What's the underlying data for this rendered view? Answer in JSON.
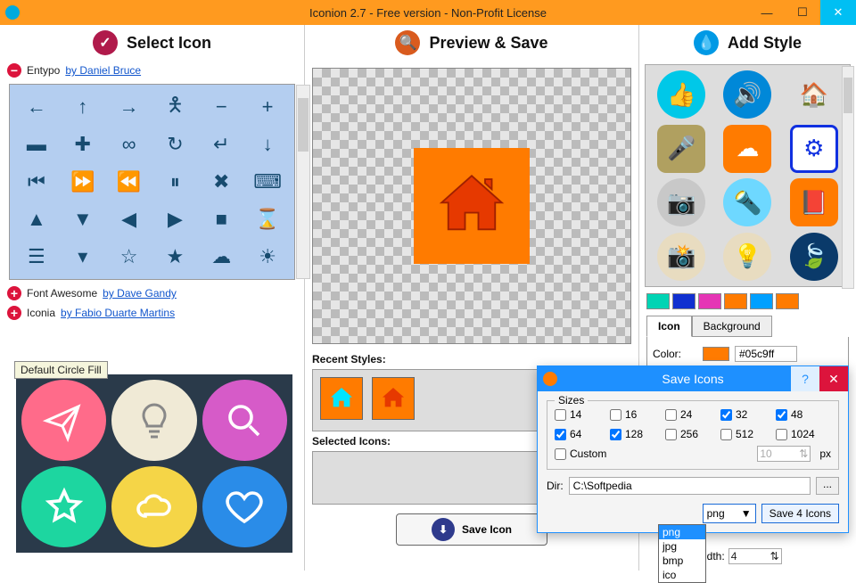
{
  "window": {
    "title": "Iconion 2.7 - Free version - Non-Profit License"
  },
  "headers": {
    "select": "Select Icon",
    "preview": "Preview & Save",
    "style": "Add Style"
  },
  "packages": {
    "entypo": {
      "name": "Entypo",
      "author": "by Daniel Bruce"
    },
    "fa": {
      "name": "Font Awesome",
      "author": "by Dave Gandy"
    },
    "iconia": {
      "name": "Iconia",
      "author": "by Fabio Duarte Martins"
    }
  },
  "tooltip": "Default Circle Fill",
  "recent_label": "Recent Styles:",
  "selected_label": "Selected Icons:",
  "save_icon": "Save Icon",
  "tabs": {
    "icon": "Icon",
    "bg": "Background"
  },
  "color_label": "Color:",
  "color_value": "#05c9ff",
  "swatches": [
    "#00d4b4",
    "#1030d0",
    "#e535b5",
    "#ff7b00",
    "#00a0ff",
    "#ff7b00"
  ],
  "dialog": {
    "title": "Save Icons",
    "sizes_label": "Sizes",
    "sizes": [
      {
        "v": "14",
        "c": false
      },
      {
        "v": "16",
        "c": false
      },
      {
        "v": "24",
        "c": false
      },
      {
        "v": "32",
        "c": true
      },
      {
        "v": "48",
        "c": true
      },
      {
        "v": "64",
        "c": true
      },
      {
        "v": "128",
        "c": true
      },
      {
        "v": "256",
        "c": false
      },
      {
        "v": "512",
        "c": false
      },
      {
        "v": "1024",
        "c": false
      }
    ],
    "custom": "Custom",
    "custom_val": "10",
    "px": "px",
    "dir_label": "Dir:",
    "dir": "C:\\Softpedia",
    "browse": "...",
    "fmt": "png",
    "save": "Save 4 Icons",
    "formats": [
      "png",
      "jpg",
      "bmp",
      "ico"
    ]
  },
  "width_label": "idth:",
  "width_val": "4"
}
